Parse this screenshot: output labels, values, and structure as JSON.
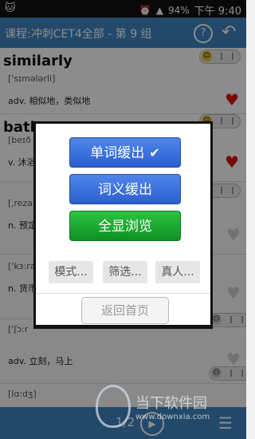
{
  "status_bar": {
    "notification_icon": "cat-icon",
    "battery": "94%",
    "time": "下午 9:40"
  },
  "app_bar": {
    "title": "课程:冲刺CET4全部 - 第 9 组",
    "help_label": "?",
    "back_icon": "back-arrow-icon"
  },
  "list": {
    "items": [
      {
        "word": "similarly",
        "phonetic": "['sɪmələrli]",
        "definition": "adv. 相似地，类似地",
        "favorite": true
      },
      {
        "word": "bathe",
        "phonetic": "[beɪð",
        "definition": "v. 沐浴",
        "favorite": true
      },
      {
        "word": "",
        "phonetic": "[ˌreza",
        "definition": "n. 预定",
        "favorite": false
      },
      {
        "word": "",
        "phonetic": "['kɜ:ra",
        "definition": "n. 货币",
        "favorite": false
      },
      {
        "word": "",
        "phonetic": "['ʃɔ:r",
        "definition": "adv. 立刻，马上",
        "favorite": false
      },
      {
        "word": "",
        "phonetic": "[lɑ:dʒ]",
        "definition": "",
        "favorite": false
      }
    ]
  },
  "dialog": {
    "option_word": "单词缓出",
    "option_word_checked": true,
    "option_meaning": "词义缓出",
    "option_full": "全显浏览",
    "mode_label": "模式...",
    "filter_label": "筛选...",
    "real_voice_label": "真人...",
    "home_label": "返回首页"
  },
  "bottom_bar": {
    "page": "1/2"
  },
  "watermark": {
    "text": "当下软件园",
    "url": "www.downxia.com"
  },
  "colors": {
    "app_blue": "#3e86c2",
    "button_blue": "#3568db",
    "button_green": "#1aa82f",
    "heart_red": "#d11111"
  }
}
